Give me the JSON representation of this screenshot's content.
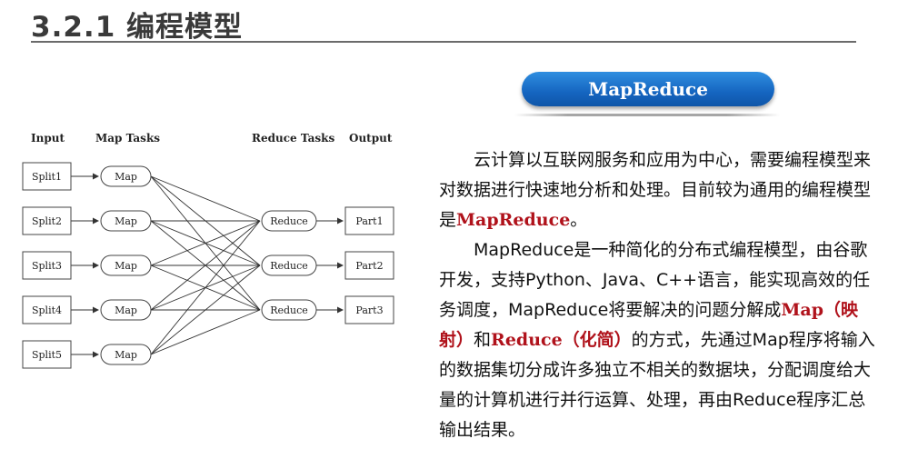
{
  "page": {
    "title": "3.2.1 编程模型",
    "badge": "MapReduce"
  },
  "diagram": {
    "headers": {
      "input": "Input",
      "map_tasks": "Map Tasks",
      "reduce_tasks": "Reduce Tasks",
      "output": "Output"
    },
    "splits": [
      "Split1",
      "Split2",
      "Split3",
      "Split4",
      "Split5"
    ],
    "map_label": "Map",
    "reduce_label": "Reduce",
    "parts": [
      "Part1",
      "Part2",
      "Part3"
    ]
  },
  "body": {
    "p1": [
      {
        "text": "云计算以互联网服务和应用为中心，需要编程模型来对数据进行快速地分析和处理。目前较为通用的编程模型是",
        "hl": false
      },
      {
        "text": "MapReduce",
        "hl": true
      },
      {
        "text": "。",
        "hl": false
      }
    ],
    "p2": [
      {
        "text": "MapReduce是一种简化的分布式编程模型，由谷歌开发，支持Python、Java、C++语言，能实现高效的任务调度，MapReduce将要解决的问题分解成",
        "hl": false
      },
      {
        "text": "Map（映射）",
        "hl": true
      },
      {
        "text": "和",
        "hl": false
      },
      {
        "text": "Reduce（化简）",
        "hl": true
      },
      {
        "text": "的方式，先通过Map程序将输入的数据集切分成许多独立不相关的数据块，分配调度给大量的计算机进行并行运算、处理，再由Reduce程序汇总输出结果。",
        "hl": false
      }
    ]
  }
}
